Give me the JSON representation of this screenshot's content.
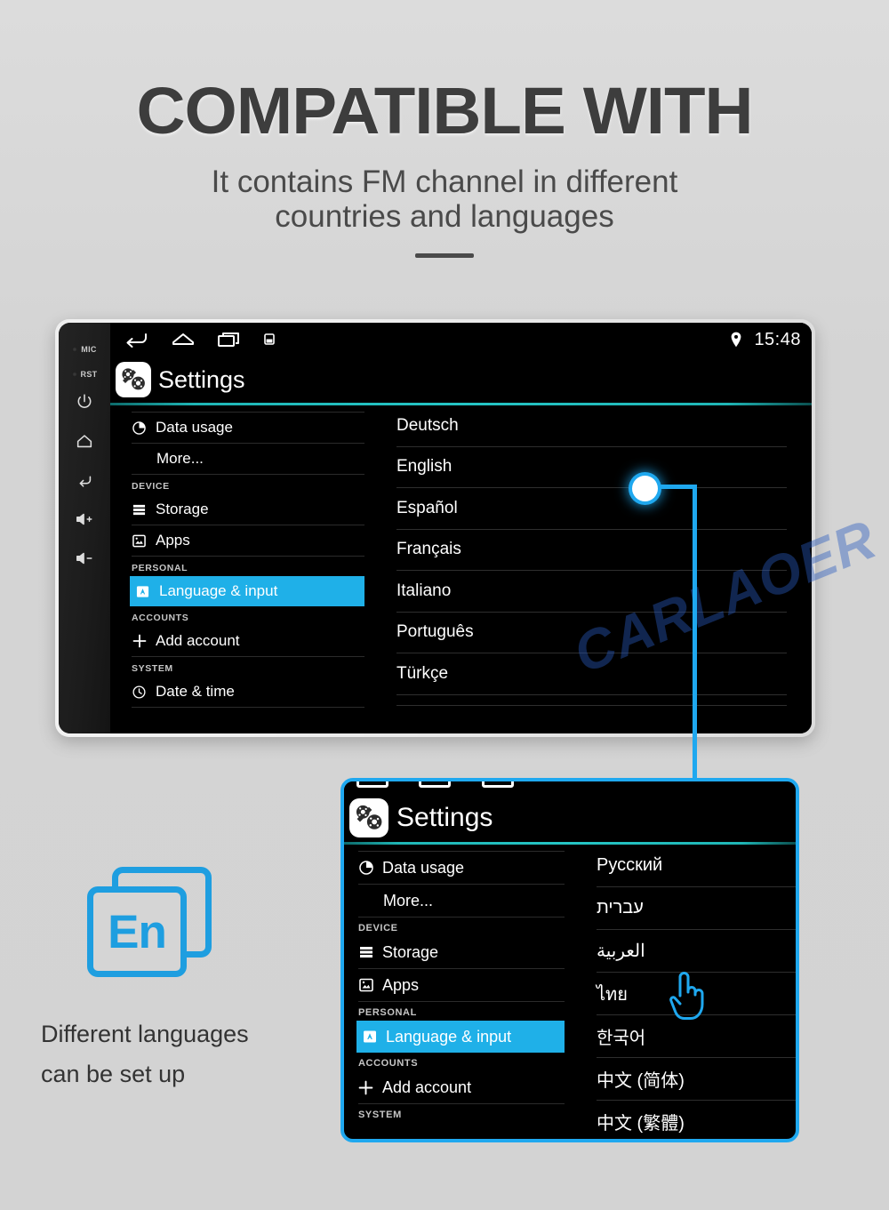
{
  "hero": {
    "title": "COMPATIBLE WITH",
    "subtitle_line1": "It contains FM channel in different",
    "subtitle_line2": "countries and languages"
  },
  "colors": {
    "accent_blue": "#1fa8ef",
    "highlight_blue": "#1fb0e8",
    "teal_rule": "#25c5c5",
    "page_bg": "#d5d5d5",
    "en_blue": "#1e9ee0",
    "watermark": "#285abe"
  },
  "device": {
    "bezel": {
      "leds": [
        {
          "label": "MIC",
          "icon": "mic-led"
        },
        {
          "label": "RST",
          "icon": "reset-led"
        }
      ],
      "buttons": [
        {
          "name": "power-button",
          "icon": "power-icon"
        },
        {
          "name": "home-button",
          "icon": "home-icon"
        },
        {
          "name": "back-button",
          "icon": "back-icon"
        },
        {
          "name": "volume-up-button",
          "icon": "volume-up-icon"
        },
        {
          "name": "volume-down-button",
          "icon": "volume-down-icon"
        }
      ]
    },
    "statusbar": {
      "nav_icons": [
        "back-icon",
        "home-icon",
        "recents-icon",
        "screenshot-icon"
      ],
      "location_icon": "location-pin-icon",
      "time": "15:48"
    },
    "app": {
      "icon": "settings-gear-icon",
      "title": "Settings"
    },
    "settings_menu": [
      {
        "label": "Data usage",
        "icon": "data-usage-icon",
        "type": "item",
        "selected": false
      },
      {
        "label": "More...",
        "icon": "",
        "type": "item-plain",
        "selected": false
      },
      {
        "label": "DEVICE",
        "type": "section"
      },
      {
        "label": "Storage",
        "icon": "storage-icon",
        "type": "item",
        "selected": false
      },
      {
        "label": "Apps",
        "icon": "apps-icon",
        "type": "item",
        "selected": false
      },
      {
        "label": "PERSONAL",
        "type": "section"
      },
      {
        "label": "Language & input",
        "icon": "language-icon",
        "type": "item",
        "selected": true
      },
      {
        "label": "ACCOUNTS",
        "type": "section"
      },
      {
        "label": "Add account",
        "icon": "plus-icon",
        "type": "item",
        "selected": false
      },
      {
        "label": "SYSTEM",
        "type": "section"
      },
      {
        "label": "Date & time",
        "icon": "clock-icon",
        "type": "item",
        "selected": false
      }
    ],
    "language_list": [
      "Deutsch",
      "English",
      "Español",
      "Français",
      "Italiano",
      "Português",
      "Türkçe"
    ]
  },
  "zoom_panel": {
    "app": {
      "icon": "settings-gear-icon",
      "title": "Settings"
    },
    "settings_menu": [
      {
        "label": "Data usage",
        "icon": "data-usage-icon",
        "type": "item",
        "selected": false
      },
      {
        "label": "More...",
        "icon": "",
        "type": "item-plain",
        "selected": false
      },
      {
        "label": "DEVICE",
        "type": "section"
      },
      {
        "label": "Storage",
        "icon": "storage-icon",
        "type": "item",
        "selected": false
      },
      {
        "label": "Apps",
        "icon": "apps-icon",
        "type": "item",
        "selected": false
      },
      {
        "label": "PERSONAL",
        "type": "section"
      },
      {
        "label": "Language & input",
        "icon": "language-icon",
        "type": "item",
        "selected": true
      },
      {
        "label": "ACCOUNTS",
        "type": "section"
      },
      {
        "label": "Add account",
        "icon": "plus-icon",
        "type": "item",
        "selected": false
      },
      {
        "label": "SYSTEM",
        "type": "section"
      }
    ],
    "language_list": [
      "Русский",
      "עברית",
      "العربية",
      "ไทย",
      "한국어",
      "中文 (简体)",
      "中文 (繁體)"
    ],
    "cursor_icon": "pointing-hand-cursor"
  },
  "en_block": {
    "badge_text": "En",
    "badge_icon": "language-cards-icon",
    "caption_line1": "Different languages",
    "caption_line2": "can be set up"
  },
  "watermark": {
    "text": "CARLAOER"
  }
}
